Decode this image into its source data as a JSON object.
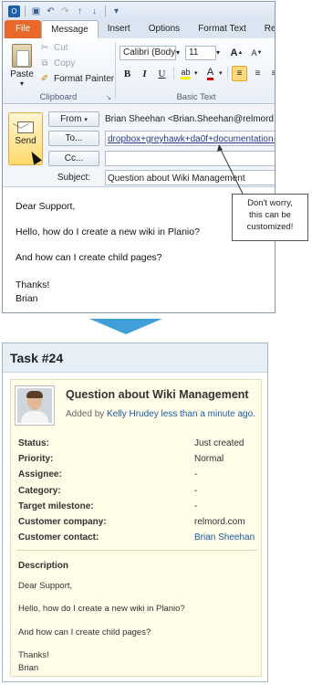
{
  "outlook": {
    "tabs": [
      "File",
      "Message",
      "Insert",
      "Options",
      "Format Text",
      "Re"
    ],
    "clipboard": {
      "paste": "Paste",
      "cut": "Cut",
      "copy": "Copy",
      "format_painter": "Format Painter",
      "label": "Clipboard"
    },
    "basic_text": {
      "font": "Calibri (Body",
      "size": "11",
      "label": "Basic Text"
    },
    "compose": {
      "send": "Send",
      "from_btn": "From",
      "from_value": "Brian Sheehan <Brian.Sheehan@relmord.com>",
      "to_btn": "To...",
      "to_value": "dropbox+greyhawk+da0f+documentation-proje",
      "cc_btn": "Cc...",
      "cc_value": "",
      "subject_label": "Subject:",
      "subject_value": "Question about Wiki Management"
    },
    "body": [
      "Dear Support,",
      "Hello, how do I create a new wiki in Planio?",
      "And how can I create child pages?",
      "Thanks!",
      "Brian"
    ],
    "callout": [
      "Don't worry,",
      "this can be",
      "customized!"
    ]
  },
  "task": {
    "title": "Task #24",
    "subject": "Question about Wiki Management",
    "added_prefix": "Added by",
    "added_user": "Kelly Hrudey",
    "added_time": "less than a minute ago.",
    "attributes": [
      {
        "label": "Status:",
        "value": "Just created"
      },
      {
        "label": "Priority:",
        "value": "Normal"
      },
      {
        "label": "Assignee:",
        "value": "-"
      },
      {
        "label": "Category:",
        "value": "-"
      },
      {
        "label": "Target milestone:",
        "value": "-"
      },
      {
        "label": "Customer company:",
        "value": "relmord.com"
      },
      {
        "label": "Customer contact:",
        "value": "Brian Sheehan"
      }
    ],
    "description_heading": "Description",
    "description": [
      "Dear Support,",
      "Hello, how do I create a new wiki in Planio?",
      "And how can I create child pages?",
      "Thanks!",
      "Brian"
    ]
  }
}
